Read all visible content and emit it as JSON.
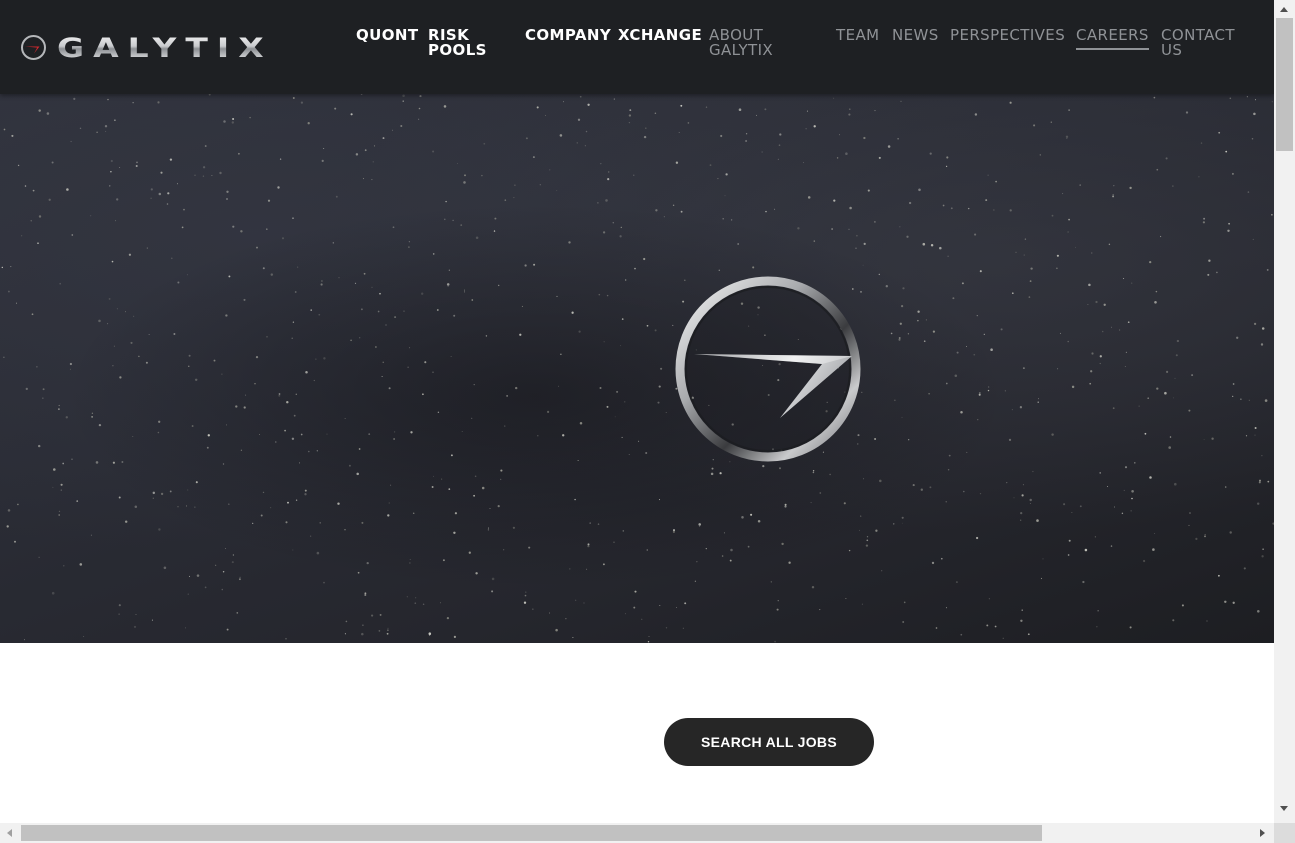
{
  "brand": {
    "name": "GALYTIX",
    "accent_color": "#d1282e"
  },
  "nav": {
    "primary": [
      {
        "label": "QUONT"
      },
      {
        "label": "RISK POOLS"
      },
      {
        "label": "COMPANY"
      },
      {
        "label": "XCHANGE"
      }
    ],
    "secondary": [
      {
        "label": "ABOUT GALYTIX"
      },
      {
        "label": "TEAM"
      },
      {
        "label": "NEWS"
      },
      {
        "label": "PERSPECTIVES"
      },
      {
        "label": "CAREERS",
        "active": true
      },
      {
        "label": "CONTACT US"
      }
    ]
  },
  "hero": {
    "emblem_icon": "galytix-emblem-icon",
    "background": "starfield"
  },
  "main": {
    "search_button_label": "SEARCH ALL JOBS"
  }
}
